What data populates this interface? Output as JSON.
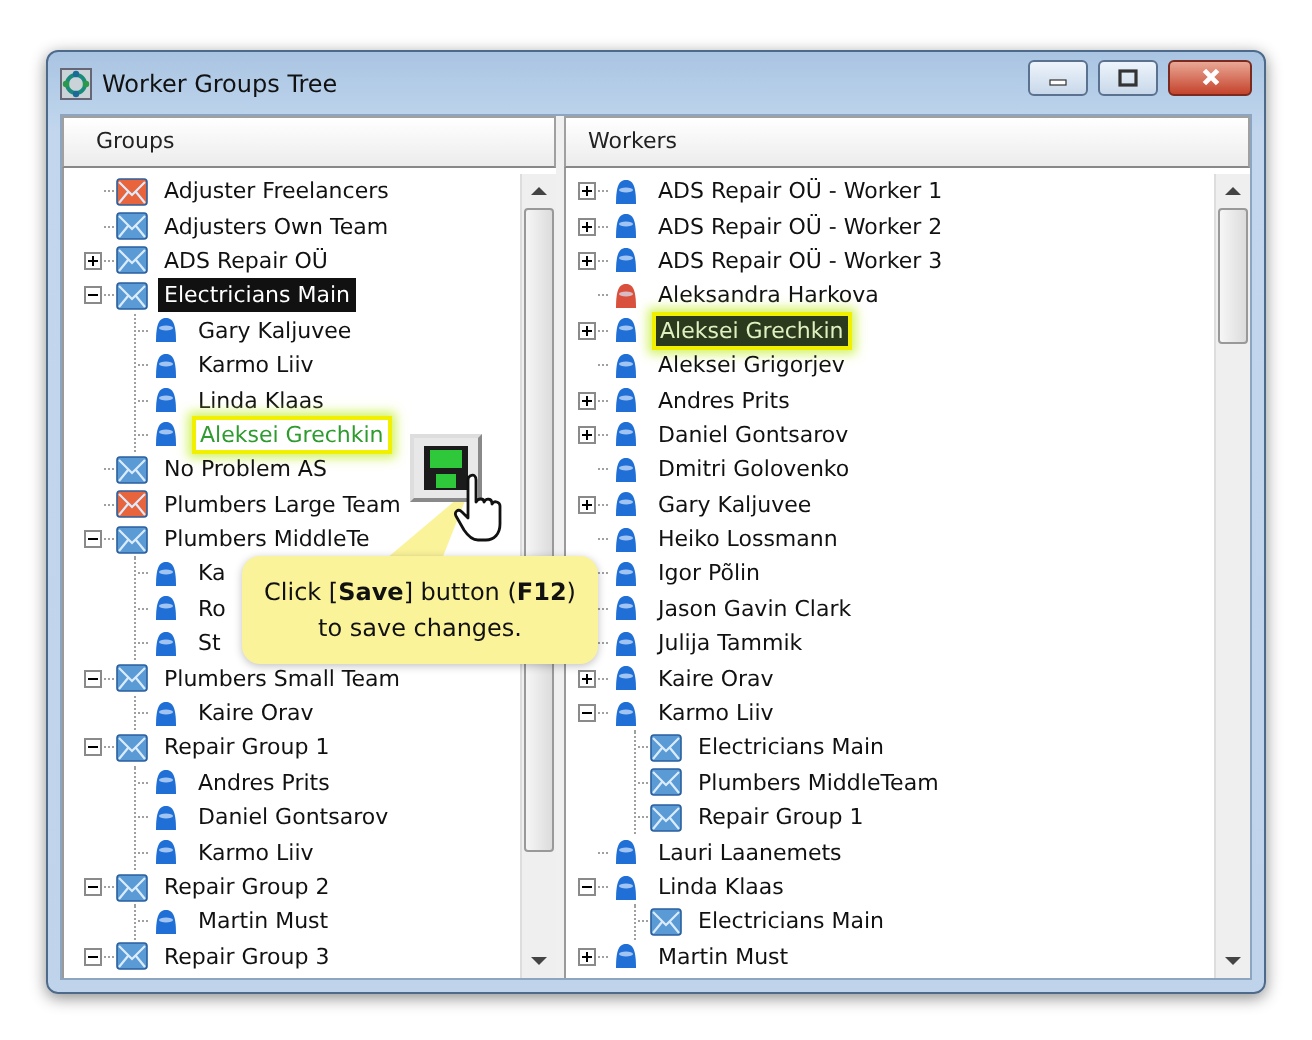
{
  "window": {
    "title": "Worker Groups Tree"
  },
  "groups_pane": {
    "header": "Groups",
    "items": [
      {
        "label": "Adjuster Freelancers",
        "kind": "group",
        "color": "#e8643c",
        "selected": false,
        "highlighted": false
      },
      {
        "label": "Adjusters Own Team",
        "kind": "group",
        "color": "#5b9bd5",
        "selected": false,
        "highlighted": false
      },
      {
        "label": "ADS Repair OÜ",
        "kind": "group",
        "color": "#5b9bd5",
        "expanded": false,
        "selected": false,
        "highlighted": false
      },
      {
        "label": "Electricians Main",
        "kind": "group",
        "color": "#5b9bd5",
        "expanded": true,
        "selected": true,
        "highlighted": false,
        "children": [
          {
            "label": "Gary Kaljuvee",
            "kind": "worker",
            "color": "#1f6fd6",
            "selected": false,
            "highlighted": false
          },
          {
            "label": "Karmo Liiv",
            "kind": "worker",
            "color": "#1f6fd6",
            "selected": false,
            "highlighted": false
          },
          {
            "label": "Linda Klaas",
            "kind": "worker",
            "color": "#1f6fd6",
            "selected": false,
            "highlighted": false
          },
          {
            "label": "Aleksei Grechkin",
            "kind": "worker",
            "color": "#1f6fd6",
            "selected": false,
            "highlighted": true
          }
        ]
      },
      {
        "label": "No Problem AS",
        "kind": "group",
        "color": "#5b9bd5",
        "selected": false,
        "highlighted": false
      },
      {
        "label": "Plumbers Large Team",
        "kind": "group",
        "color": "#e8643c",
        "selected": false,
        "highlighted": false
      },
      {
        "label": "Plumbers MiddleTe",
        "kind": "group",
        "color": "#5b9bd5",
        "expanded": true,
        "selected": false,
        "highlighted": false,
        "children": [
          {
            "label": "Ka",
            "kind": "worker",
            "color": "#1f6fd6",
            "selected": false,
            "highlighted": false
          },
          {
            "label": "Ro",
            "kind": "worker",
            "color": "#1f6fd6",
            "selected": false,
            "highlighted": false
          },
          {
            "label": "St",
            "kind": "worker",
            "color": "#1f6fd6",
            "selected": false,
            "highlighted": false
          }
        ]
      },
      {
        "label": "Plumbers Small Team",
        "kind": "group",
        "color": "#5b9bd5",
        "expanded": true,
        "selected": false,
        "highlighted": false,
        "children": [
          {
            "label": "Kaire Orav",
            "kind": "worker",
            "color": "#1f6fd6",
            "selected": false,
            "highlighted": false
          }
        ]
      },
      {
        "label": "Repair Group 1",
        "kind": "group",
        "color": "#5b9bd5",
        "expanded": true,
        "selected": false,
        "highlighted": false,
        "children": [
          {
            "label": "Andres Prits",
            "kind": "worker",
            "color": "#1f6fd6",
            "selected": false,
            "highlighted": false
          },
          {
            "label": "Daniel Gontsarov",
            "kind": "worker",
            "color": "#1f6fd6",
            "selected": false,
            "highlighted": false
          },
          {
            "label": "Karmo Liiv",
            "kind": "worker",
            "color": "#1f6fd6",
            "selected": false,
            "highlighted": false
          }
        ]
      },
      {
        "label": "Repair Group 2",
        "kind": "group",
        "color": "#5b9bd5",
        "expanded": true,
        "selected": false,
        "highlighted": false,
        "children": [
          {
            "label": "Martin Must",
            "kind": "worker",
            "color": "#1f6fd6",
            "selected": false,
            "highlighted": false
          }
        ]
      },
      {
        "label": "Repair Group 3",
        "kind": "group",
        "color": "#5b9bd5",
        "expanded": true,
        "selected": false,
        "highlighted": false
      }
    ]
  },
  "workers_pane": {
    "header": "Workers",
    "items": [
      {
        "label": "ADS Repair OÜ - Worker 1",
        "kind": "worker",
        "color": "#1f6fd6",
        "expanded": false,
        "selected": false,
        "highlighted": false
      },
      {
        "label": "ADS Repair OÜ - Worker 2",
        "kind": "worker",
        "color": "#1f6fd6",
        "expanded": false,
        "selected": false,
        "highlighted": false
      },
      {
        "label": "ADS Repair OÜ - Worker 3",
        "kind": "worker",
        "color": "#1f6fd6",
        "expanded": false,
        "selected": false,
        "highlighted": false
      },
      {
        "label": "Aleksandra Harkova",
        "kind": "worker",
        "color": "#d9503c",
        "selected": false,
        "highlighted": false
      },
      {
        "label": "Aleksei Grechkin",
        "kind": "worker",
        "color": "#1f6fd6",
        "expanded": false,
        "selected": true,
        "highlighted": true
      },
      {
        "label": "Aleksei Grigorjev",
        "kind": "worker",
        "color": "#1f6fd6",
        "selected": false,
        "highlighted": false
      },
      {
        "label": "Andres Prits",
        "kind": "worker",
        "color": "#1f6fd6",
        "expanded": false,
        "selected": false,
        "highlighted": false
      },
      {
        "label": "Daniel Gontsarov",
        "kind": "worker",
        "color": "#1f6fd6",
        "expanded": false,
        "selected": false,
        "highlighted": false
      },
      {
        "label": "Dmitri Golovenko",
        "kind": "worker",
        "color": "#1f6fd6",
        "selected": false,
        "highlighted": false
      },
      {
        "label": "Gary Kaljuvee",
        "kind": "worker",
        "color": "#1f6fd6",
        "expanded": false,
        "selected": false,
        "highlighted": false
      },
      {
        "label": "Heiko Lossmann",
        "kind": "worker",
        "color": "#1f6fd6",
        "selected": false,
        "highlighted": false
      },
      {
        "label": "Igor Põlin",
        "kind": "worker",
        "color": "#1f6fd6",
        "selected": false,
        "highlighted": false
      },
      {
        "label": "Jason Gavin Clark",
        "kind": "worker",
        "color": "#1f6fd6",
        "selected": false,
        "highlighted": false
      },
      {
        "label": "Julija Tammik",
        "kind": "worker",
        "color": "#1f6fd6",
        "selected": false,
        "highlighted": false
      },
      {
        "label": "Kaire Orav",
        "kind": "worker",
        "color": "#1f6fd6",
        "expanded": false,
        "selected": false,
        "highlighted": false
      },
      {
        "label": "Karmo Liiv",
        "kind": "worker",
        "color": "#1f6fd6",
        "expanded": true,
        "selected": false,
        "highlighted": false,
        "children": [
          {
            "label": "Electricians Main",
            "kind": "group",
            "color": "#5b9bd5",
            "selected": false,
            "highlighted": false
          },
          {
            "label": "Plumbers MiddleTeam",
            "kind": "group",
            "color": "#5b9bd5",
            "selected": false,
            "highlighted": false
          },
          {
            "label": "Repair Group 1",
            "kind": "group",
            "color": "#5b9bd5",
            "selected": false,
            "highlighted": false
          }
        ]
      },
      {
        "label": "Lauri Laanemets",
        "kind": "worker",
        "color": "#1f6fd6",
        "selected": false,
        "highlighted": false
      },
      {
        "label": "Linda Klaas",
        "kind": "worker",
        "color": "#1f6fd6",
        "expanded": true,
        "selected": false,
        "highlighted": false,
        "children": [
          {
            "label": "Electricians Main",
            "kind": "group",
            "color": "#5b9bd5",
            "selected": false,
            "highlighted": false
          }
        ]
      },
      {
        "label": "Martin Must",
        "kind": "worker",
        "color": "#1f6fd6",
        "expanded": false,
        "selected": false,
        "highlighted": false
      }
    ]
  },
  "callout": {
    "text": "Click [**Save**] button (**F12**) to save changes."
  }
}
